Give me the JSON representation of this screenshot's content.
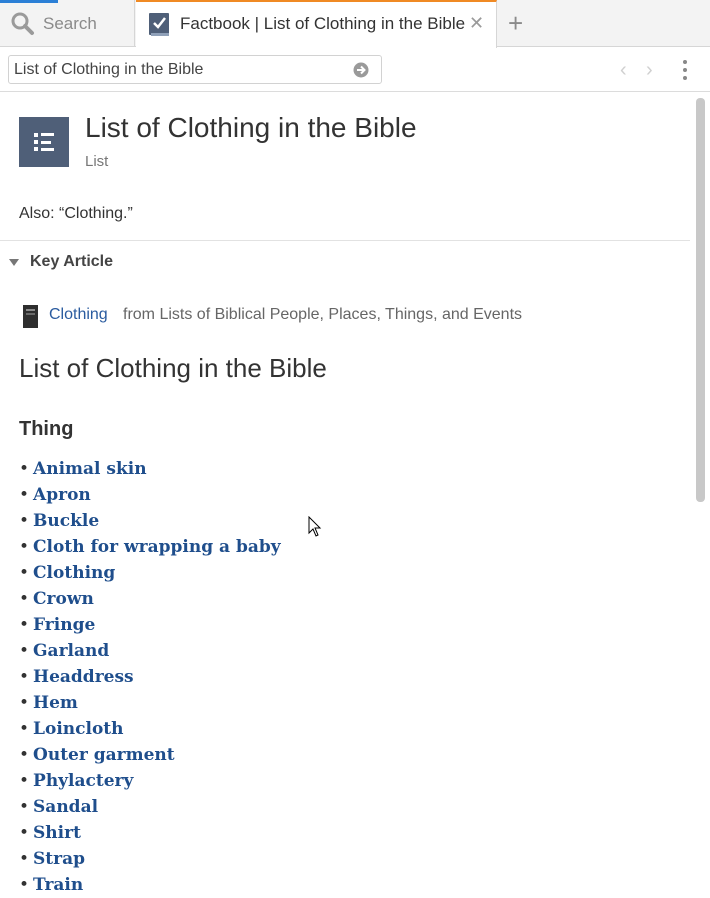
{
  "tabs": {
    "search_label": "Search",
    "active_label": "Factbook | List of Clothing in the Bible",
    "close_glyph": "✕",
    "add_glyph": "+"
  },
  "address": {
    "value": "List of Clothing in the Bible",
    "back_glyph": "‹",
    "forward_glyph": "›"
  },
  "article": {
    "title": "List of Clothing in the Bible",
    "type": "List",
    "also": "Also: “Clothing.”"
  },
  "key_article": {
    "heading": "Key Article",
    "link": "Clothing",
    "source": "from Lists of Biblical People, Places, Things, and Events"
  },
  "section": {
    "title": "List of Clothing in the Bible",
    "subheading": "Thing",
    "bullet": "•",
    "items": [
      "Animal skin",
      "Apron",
      "Buckle",
      "Cloth for wrapping a baby",
      "Clothing",
      "Crown",
      "Fringe",
      "Garland",
      "Headdress",
      "Hem",
      "Loincloth",
      "Outer garment",
      "Phylactery",
      "Sandal",
      "Shirt",
      "Strap",
      "Train"
    ]
  },
  "colors": {
    "tab_accent": "#f08a24",
    "link": "#1f4e8c",
    "list_icon_bg": "#4f5f78"
  }
}
